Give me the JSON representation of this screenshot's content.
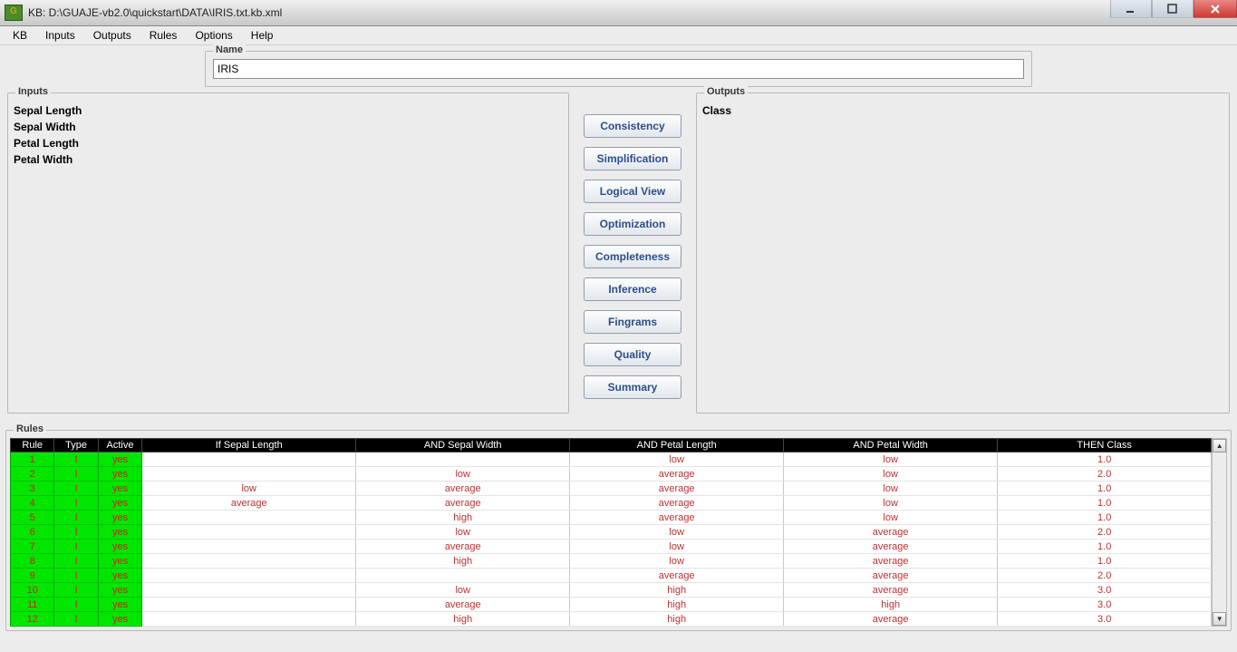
{
  "window": {
    "title": "KB: D:\\GUAJE-vb2.0\\quickstart\\DATA\\IRIS.txt.kb.xml"
  },
  "menubar": {
    "items": [
      "KB",
      "Inputs",
      "Outputs",
      "Rules",
      "Options",
      "Help"
    ]
  },
  "name_group": {
    "legend": "Name",
    "value": "IRIS"
  },
  "inputs_group": {
    "legend": "Inputs",
    "items": [
      "Sepal Length",
      "Sepal Width",
      "Petal Length",
      "Petal Width"
    ]
  },
  "outputs_group": {
    "legend": "Outputs",
    "items": [
      "Class"
    ]
  },
  "center_actions": [
    "Consistency",
    "Simplification",
    "Logical View",
    "Optimization",
    "Completeness",
    "Inference",
    "Fingrams",
    "Quality",
    "Summary"
  ],
  "rules_group": {
    "legend": "Rules",
    "headers": [
      "Rule",
      "Type",
      "Active",
      "If Sepal Length",
      "AND Sepal Width",
      "AND Petal Length",
      "AND Petal Width",
      "THEN Class"
    ],
    "rows": [
      {
        "n": "1",
        "type": "I",
        "active": "yes",
        "c1": "",
        "c2": "",
        "c3": "low",
        "c4": "low",
        "r": "1.0"
      },
      {
        "n": "2",
        "type": "I",
        "active": "yes",
        "c1": "",
        "c2": "low",
        "c3": "average",
        "c4": "low",
        "r": "2.0"
      },
      {
        "n": "3",
        "type": "I",
        "active": "yes",
        "c1": "low",
        "c2": "average",
        "c3": "average",
        "c4": "low",
        "r": "1.0"
      },
      {
        "n": "4",
        "type": "I",
        "active": "yes",
        "c1": "average",
        "c2": "average",
        "c3": "average",
        "c4": "low",
        "r": "1.0"
      },
      {
        "n": "5",
        "type": "I",
        "active": "yes",
        "c1": "",
        "c2": "high",
        "c3": "average",
        "c4": "low",
        "r": "1.0"
      },
      {
        "n": "6",
        "type": "I",
        "active": "yes",
        "c1": "",
        "c2": "low",
        "c3": "low",
        "c4": "average",
        "r": "2.0"
      },
      {
        "n": "7",
        "type": "I",
        "active": "yes",
        "c1": "",
        "c2": "average",
        "c3": "low",
        "c4": "average",
        "r": "1.0"
      },
      {
        "n": "8",
        "type": "I",
        "active": "yes",
        "c1": "",
        "c2": "high",
        "c3": "low",
        "c4": "average",
        "r": "1.0"
      },
      {
        "n": "9",
        "type": "I",
        "active": "yes",
        "c1": "",
        "c2": "",
        "c3": "average",
        "c4": "average",
        "r": "2.0"
      },
      {
        "n": "10",
        "type": "I",
        "active": "yes",
        "c1": "",
        "c2": "low",
        "c3": "high",
        "c4": "average",
        "r": "3.0"
      },
      {
        "n": "11",
        "type": "I",
        "active": "yes",
        "c1": "",
        "c2": "average",
        "c3": "high",
        "c4": "high",
        "r": "3.0"
      },
      {
        "n": "12",
        "type": "I",
        "active": "yes",
        "c1": "",
        "c2": "high",
        "c3": "high",
        "c4": "average",
        "r": "3.0"
      }
    ]
  }
}
